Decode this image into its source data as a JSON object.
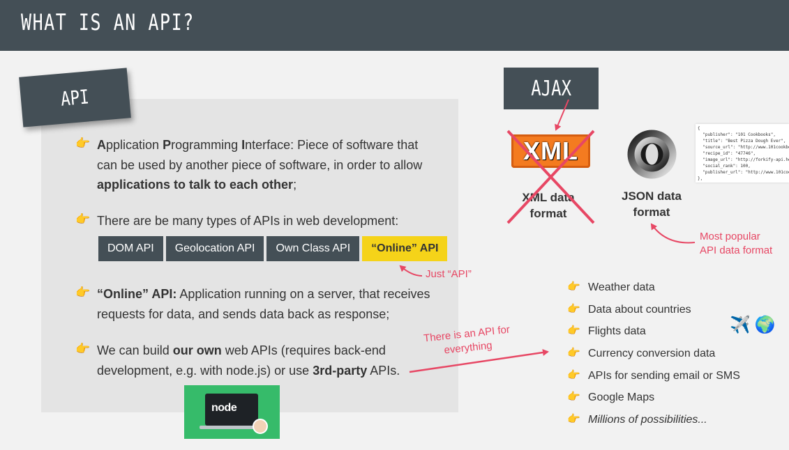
{
  "header": {
    "title": "WHAT IS AN API?"
  },
  "tag": {
    "api": "API",
    "ajax": "AJAX"
  },
  "bullets": {
    "b1": {
      "p1": "A",
      "p2": "pplication ",
      "p3": "P",
      "p4": "rogramming ",
      "p5": "I",
      "p6": "nterface: Piece of software that can be used by another piece of software, in order to allow ",
      "p7": "applications to talk to each other",
      "p8": ";"
    },
    "b2": {
      "text": "There are be many types of APIs in web development:"
    },
    "b3": {
      "p1": "“Online” API:",
      "p2": " Application running on a server, that receives requests for data, and sends data back as response;"
    },
    "b4": {
      "p1": "We can build ",
      "p2": "our own",
      "p3": " web APIs (requires back-end development, e.g. with node.js) or use ",
      "p4": "3rd-party",
      "p5": " APIs."
    }
  },
  "pills": [
    "DOM API",
    "Geolocation API",
    "Own Class API",
    "“Online” API"
  ],
  "annotations": {
    "just_api": "Just “API”",
    "everything_1": "There is an API for",
    "everything_2": "everything",
    "most_popular_1": "Most popular",
    "most_popular_2": "API data format"
  },
  "formats": {
    "xml_logo": "XML",
    "xml_caption_1": "XML data",
    "xml_caption_2": "format",
    "json_caption_1": "JSON data",
    "json_caption_2": "format"
  },
  "code_lines": [
    "{",
    "  \"publisher\": \"101 Cookbooks\",",
    "  \"title\": \"Best Pizza Dough Ever\",",
    "  \"source_url\": \"http://www.101cookbooks.com\",",
    "  \"recipe_id\": \"47746\",",
    "  \"image_url\": \"http://forkify-api.herokuapp.com\",",
    "  \"social_rank\": 100,",
    "  \"publisher_url\": \"http://www.101cookbooks.com\"",
    "},"
  ],
  "list": [
    "Weather data",
    "Data about countries",
    "Flights data",
    "Currency conversion data",
    "APIs for sending email or SMS",
    "Google Maps",
    "Millions of possibilities..."
  ],
  "emoji": {
    "plane": "✈️",
    "globe": "🌍"
  },
  "node_image": {
    "word": "node"
  },
  "icons": {
    "bullet": "hand-pointing-right-icon"
  },
  "colors": {
    "header": "#444f56",
    "accent": "#e74764",
    "highlight": "#f5d319",
    "xml_orange": "#f47b20"
  }
}
